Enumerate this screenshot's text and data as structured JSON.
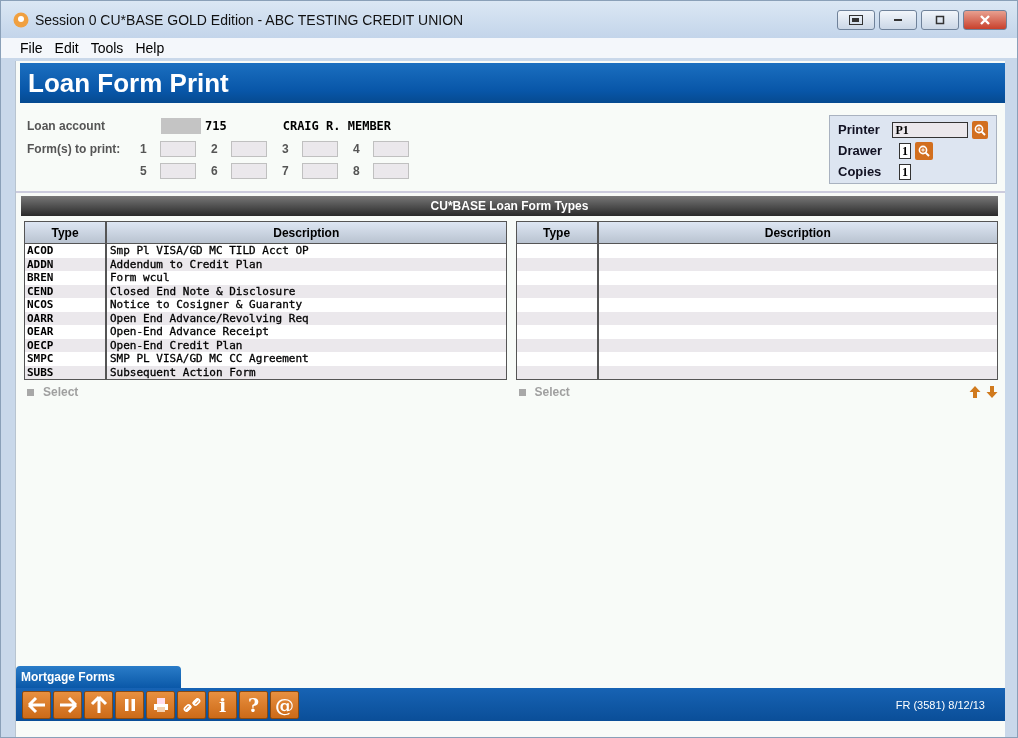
{
  "window": {
    "title": "Session 0 CU*BASE GOLD Edition - ABC TESTING CREDIT UNION"
  },
  "menu": [
    "File",
    "Edit",
    "Tools",
    "Help"
  ],
  "header": {
    "title": "Loan Form Print"
  },
  "loan_account": {
    "label": "Loan account",
    "value": "715",
    "member_name": "CRAIG R. MEMBER"
  },
  "forms_to_print": {
    "label": "Form(s) to print:",
    "fields": [
      {
        "number": "1"
      },
      {
        "number": "2"
      },
      {
        "number": "3"
      },
      {
        "number": "4"
      },
      {
        "number": "5"
      },
      {
        "number": "6"
      },
      {
        "number": "7"
      },
      {
        "number": "8"
      }
    ]
  },
  "printer_panel": [
    {
      "label": "Printer",
      "value": "P1",
      "kind": "wide",
      "lookup": true
    },
    {
      "label": "Drawer",
      "value": "1",
      "kind": "short",
      "lookup": true
    },
    {
      "label": "Copies",
      "value": "1",
      "kind": "short",
      "lookup": false
    }
  ],
  "section_title": "CU*BASE Loan Form Types",
  "tables": [
    {
      "columns": [
        "Type",
        "Description"
      ],
      "action": "Select",
      "rows": [
        {
          "type": "ACOD",
          "description": "Smp Pl VISA/GD MC TILD Acct OP"
        },
        {
          "type": "ADDN",
          "description": "Addendum to Credit Plan"
        },
        {
          "type": "BREN",
          "description": "Form wcul"
        },
        {
          "type": "CEND",
          "description": "Closed End Note & Disclosure"
        },
        {
          "type": "NCOS",
          "description": "Notice to Cosigner & Guaranty"
        },
        {
          "type": "OARR",
          "description": "Open End Advance/Revolving Req"
        },
        {
          "type": "OEAR",
          "description": "Open-End Advance Receipt"
        },
        {
          "type": "OECP",
          "description": "Open-End Credit Plan"
        },
        {
          "type": "SMPC",
          "description": "SMP PL VISA/GD MC CC Agreement"
        },
        {
          "type": "SUBS",
          "description": "Subsequent Action Form"
        }
      ]
    },
    {
      "columns": [
        "Type",
        "Description"
      ],
      "action": "Select"
    }
  ],
  "bottom_tab": "Mortgage Forms",
  "toolbar": [
    {
      "kind": "back"
    },
    {
      "kind": "forward"
    },
    {
      "kind": "up"
    },
    {
      "kind": "pause"
    },
    {
      "kind": "print"
    },
    {
      "kind": "link"
    },
    {
      "kind": "char",
      "label": "i"
    },
    {
      "kind": "char",
      "label": "?"
    },
    {
      "kind": "char",
      "label": "@"
    }
  ],
  "status": "FR (3581) 8/12/13"
}
